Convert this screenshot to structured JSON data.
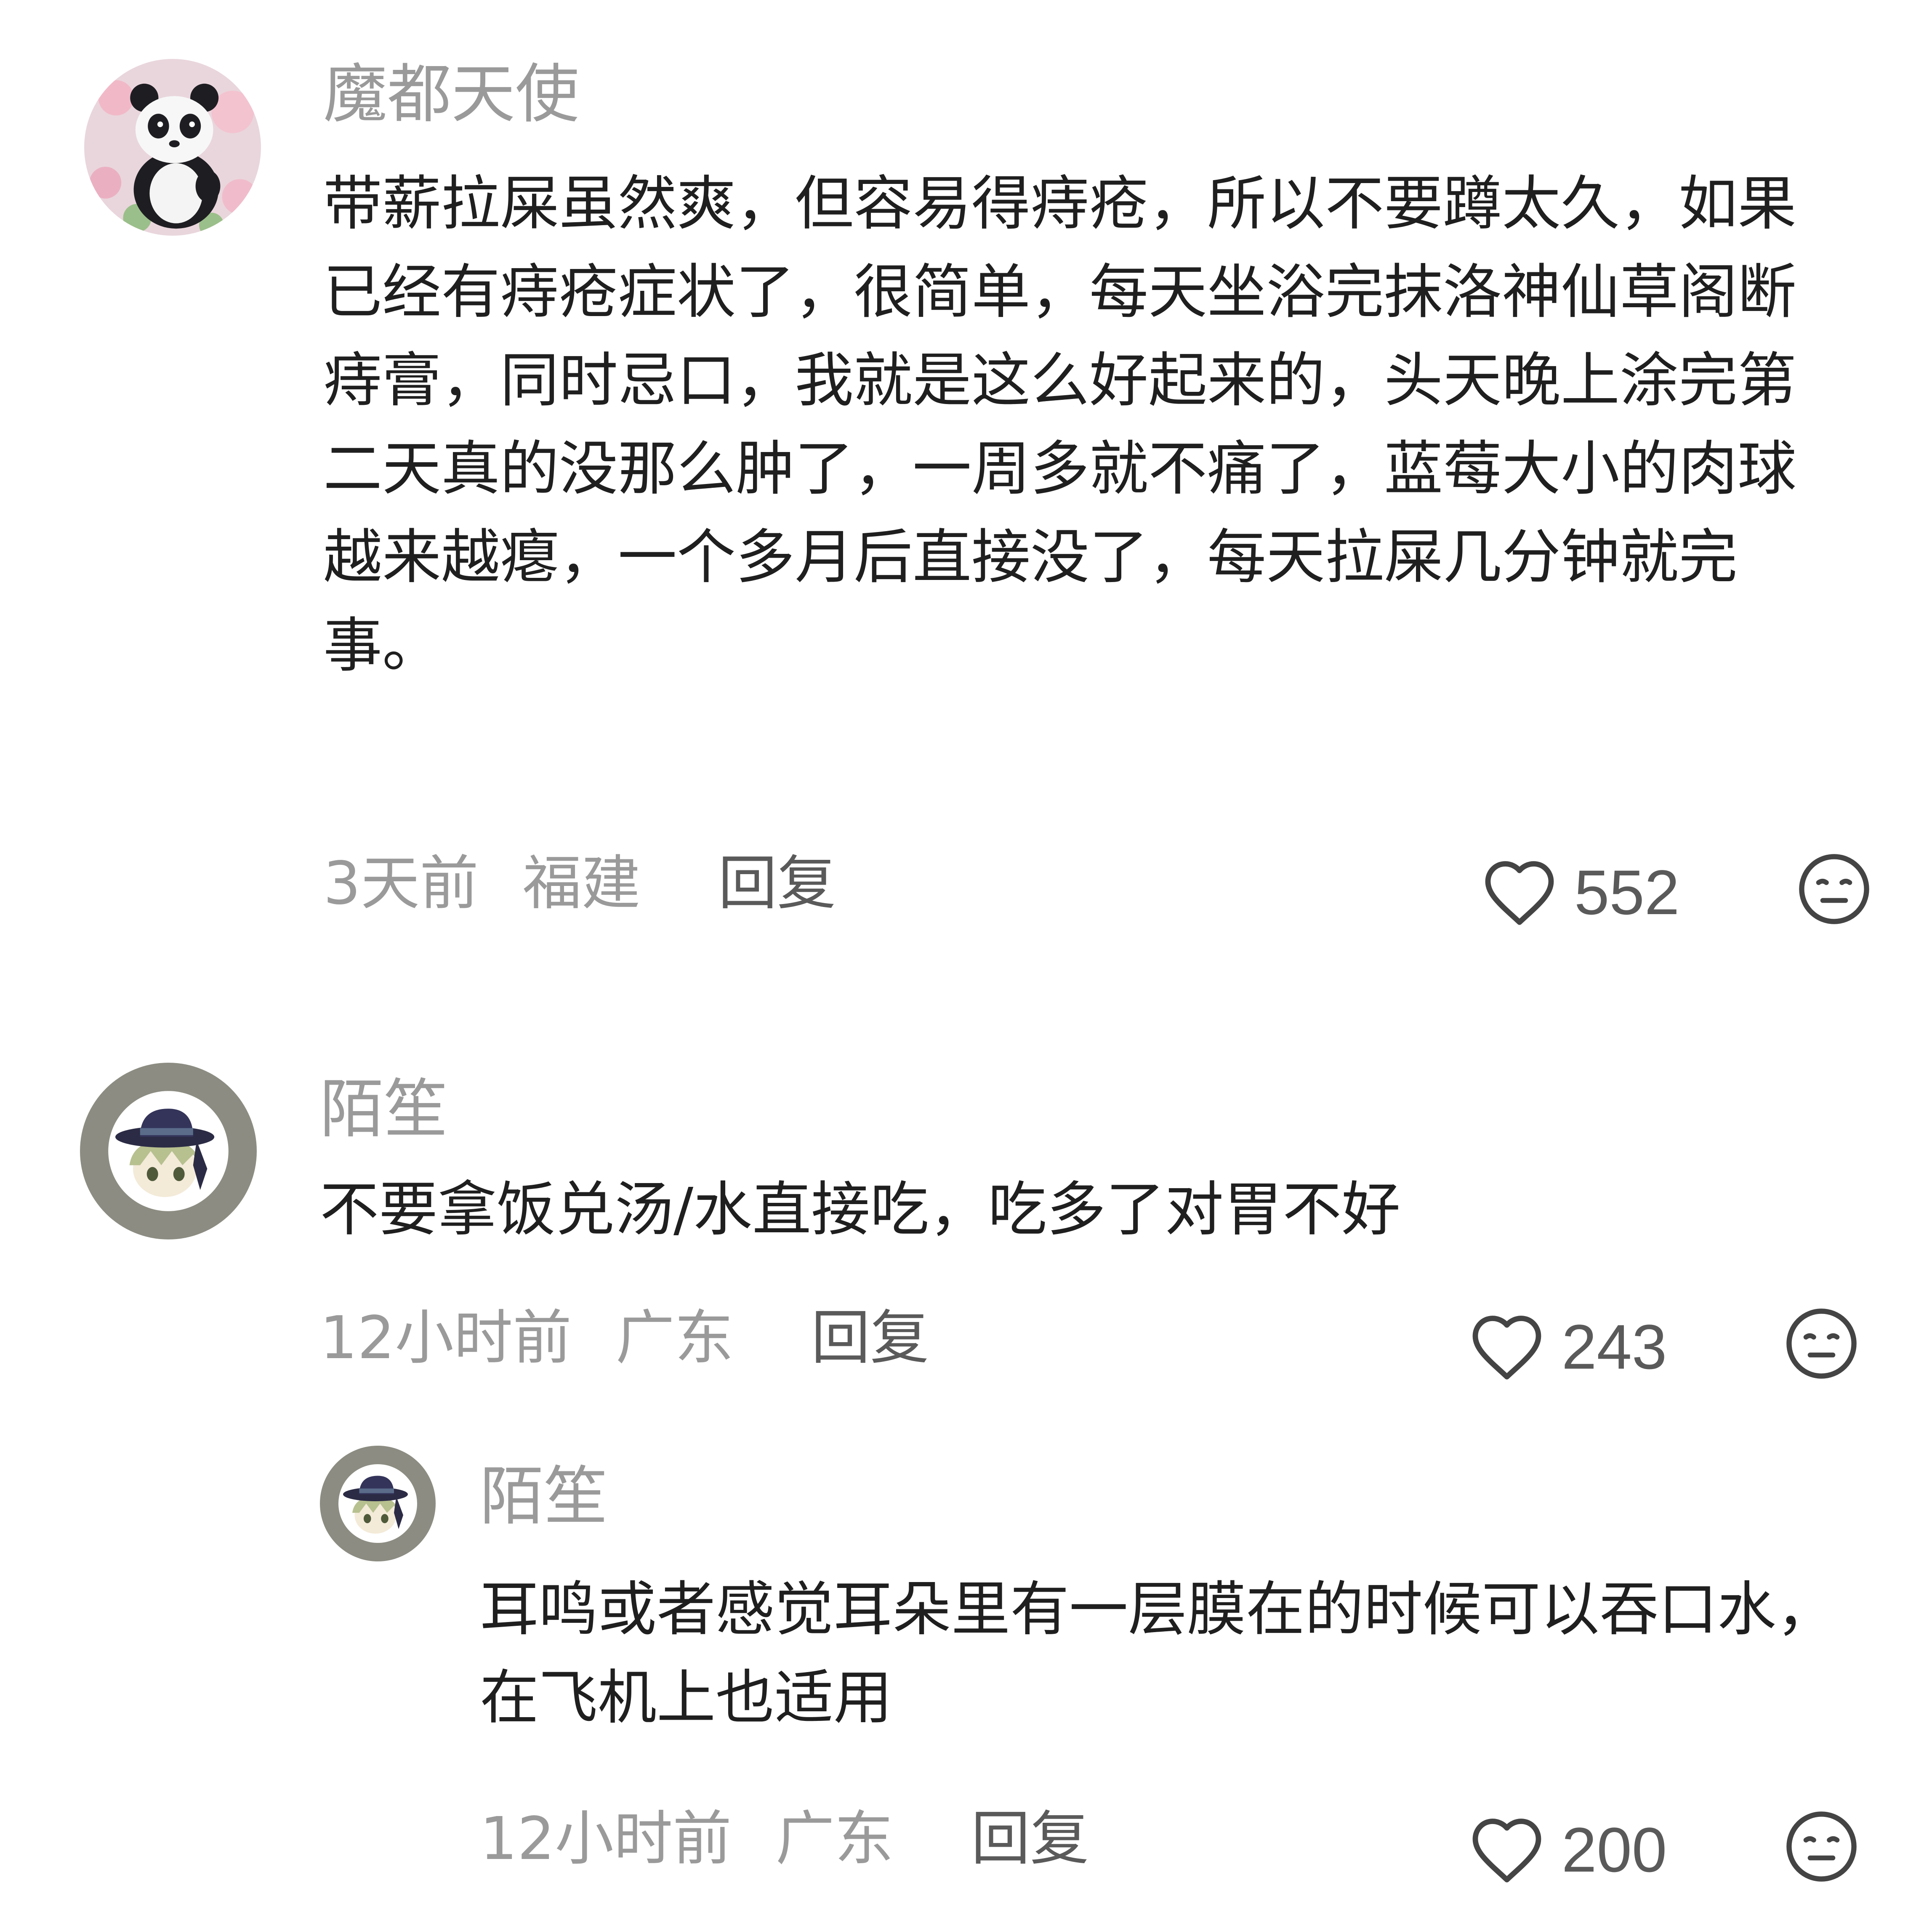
{
  "comments": [
    {
      "username": "魔都天使",
      "avatar_icon": "panda-avatar-icon",
      "text": "带薪拉屎虽然爽，但容易得痔疮，所以不要蹲太久，如果已经有痔疮症状了，很简单，每天坐浴完抹洛神仙草阁断痔膏，同时忌口，我就是这么好起来的，头天晚上涂完第二天真的没那么肿了，一周多就不痛了，蓝莓大小的肉球越来越瘪，一个多月后直接没了，每天拉屎几分钟就完事。",
      "time": "3天前",
      "region": "福建",
      "reply_label": "回复",
      "like_count": "552"
    },
    {
      "username": "陌笙",
      "avatar_icon": "hat-character-avatar-icon",
      "text": "不要拿饭兑汤/水直接吃，吃多了对胃不好",
      "time": "12小时前",
      "region": "广东",
      "reply_label": "回复",
      "like_count": "243",
      "replies": [
        {
          "username": "陌笙",
          "avatar_icon": "hat-character-avatar-icon",
          "text": "耳鸣或者感觉耳朵里有一层膜在的时候可以吞口水，在飞机上也适用",
          "time": "12小时前",
          "region": "广东",
          "reply_label": "回复",
          "like_count": "200"
        }
      ]
    }
  ],
  "icons": {
    "like": "heart-outline-icon",
    "dislike": "meh-face-icon"
  },
  "colors": {
    "username": "#9a9a9a",
    "text": "#1f1f1f",
    "meta": "#9a9a9a",
    "reply": "#5a5a5a",
    "icon": "#444444"
  }
}
